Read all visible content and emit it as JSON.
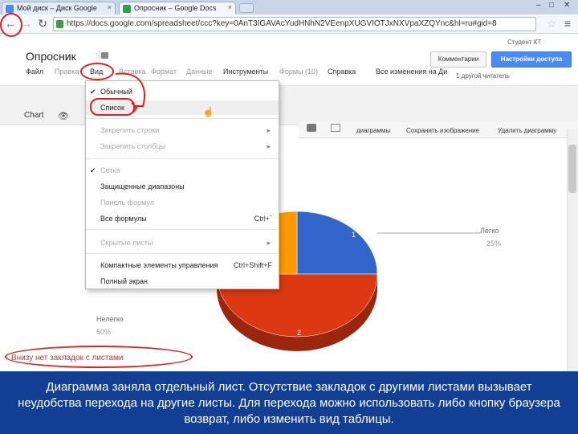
{
  "browser": {
    "tabs": [
      {
        "label": "Мой диск – Диск Google"
      },
      {
        "label": "Опросник – Google Docs"
      }
    ],
    "url": "https://docs.google.com/spreadsheet/ccc?key=0AnT3IGAVAcYudHNhN2VEenpXUGVIOTJxNXVpaXZQYnc&hl=ru#gid=8"
  },
  "docs": {
    "user": "Студент КТ",
    "title": "Опросник",
    "comments_label": "Комментарии",
    "access_label": "Настройки доступа",
    "menu": [
      "Файл",
      "Правка",
      "Вид",
      "Вставка",
      "Формат",
      "Данные",
      "Инструменты",
      "Формы (10)",
      "Справка"
    ],
    "edit_note": "Все изменения на Ди",
    "other_reader": "1 другой читатель"
  },
  "toolbar": {
    "chart_label": "Chart",
    "chart_buttons": [
      "диаграммы",
      "Сохранить изображение",
      "Удалить диаграмму"
    ]
  },
  "view_menu": {
    "items": [
      {
        "label": "Обычный",
        "checked": true,
        "disabled": false
      },
      {
        "label": "Список",
        "checked": false,
        "disabled": false,
        "highlighted": true
      },
      {
        "label": "Закрепить строки",
        "disabled": true,
        "submenu": true
      },
      {
        "label": "Закрепить столбцы",
        "disabled": true,
        "submenu": true
      },
      {
        "label": "Сетка",
        "checked": true,
        "disabled": true
      },
      {
        "label": "Защищенные диапазоны",
        "disabled": false
      },
      {
        "label": "Панель формул",
        "disabled": true
      },
      {
        "label": "Все формулы",
        "disabled": false,
        "shortcut": "Ctrl+`"
      },
      {
        "label": "Скрытые листы",
        "disabled": true,
        "submenu": true
      },
      {
        "label": "Компактные элементы управления",
        "disabled": false,
        "shortcut": "Ctrl+Shift+F"
      },
      {
        "label": "Полный экран",
        "disabled": false
      }
    ]
  },
  "chart_data": {
    "type": "pie",
    "categories": [
      "Легко",
      "Нелегко",
      ""
    ],
    "values": [
      25,
      50,
      25
    ],
    "colors": [
      "#3366cc",
      "#dc3912",
      "#ff9900"
    ],
    "slice_numbers": [
      "1",
      "2"
    ],
    "labels": [
      {
        "name": "Легко",
        "pct": "25%"
      },
      {
        "name": "Нелегко",
        "pct": "50%"
      }
    ]
  },
  "annotation": {
    "note": "Внизу нет закладок с листами"
  },
  "caption": "Диаграмма заняла отдельный лист. Отсутствие закладок с другими листами вызывает неудобства перехода на другие листы. Для перехода можно использовать либо кнопку браузера возврат, либо изменить вид таблицы."
}
